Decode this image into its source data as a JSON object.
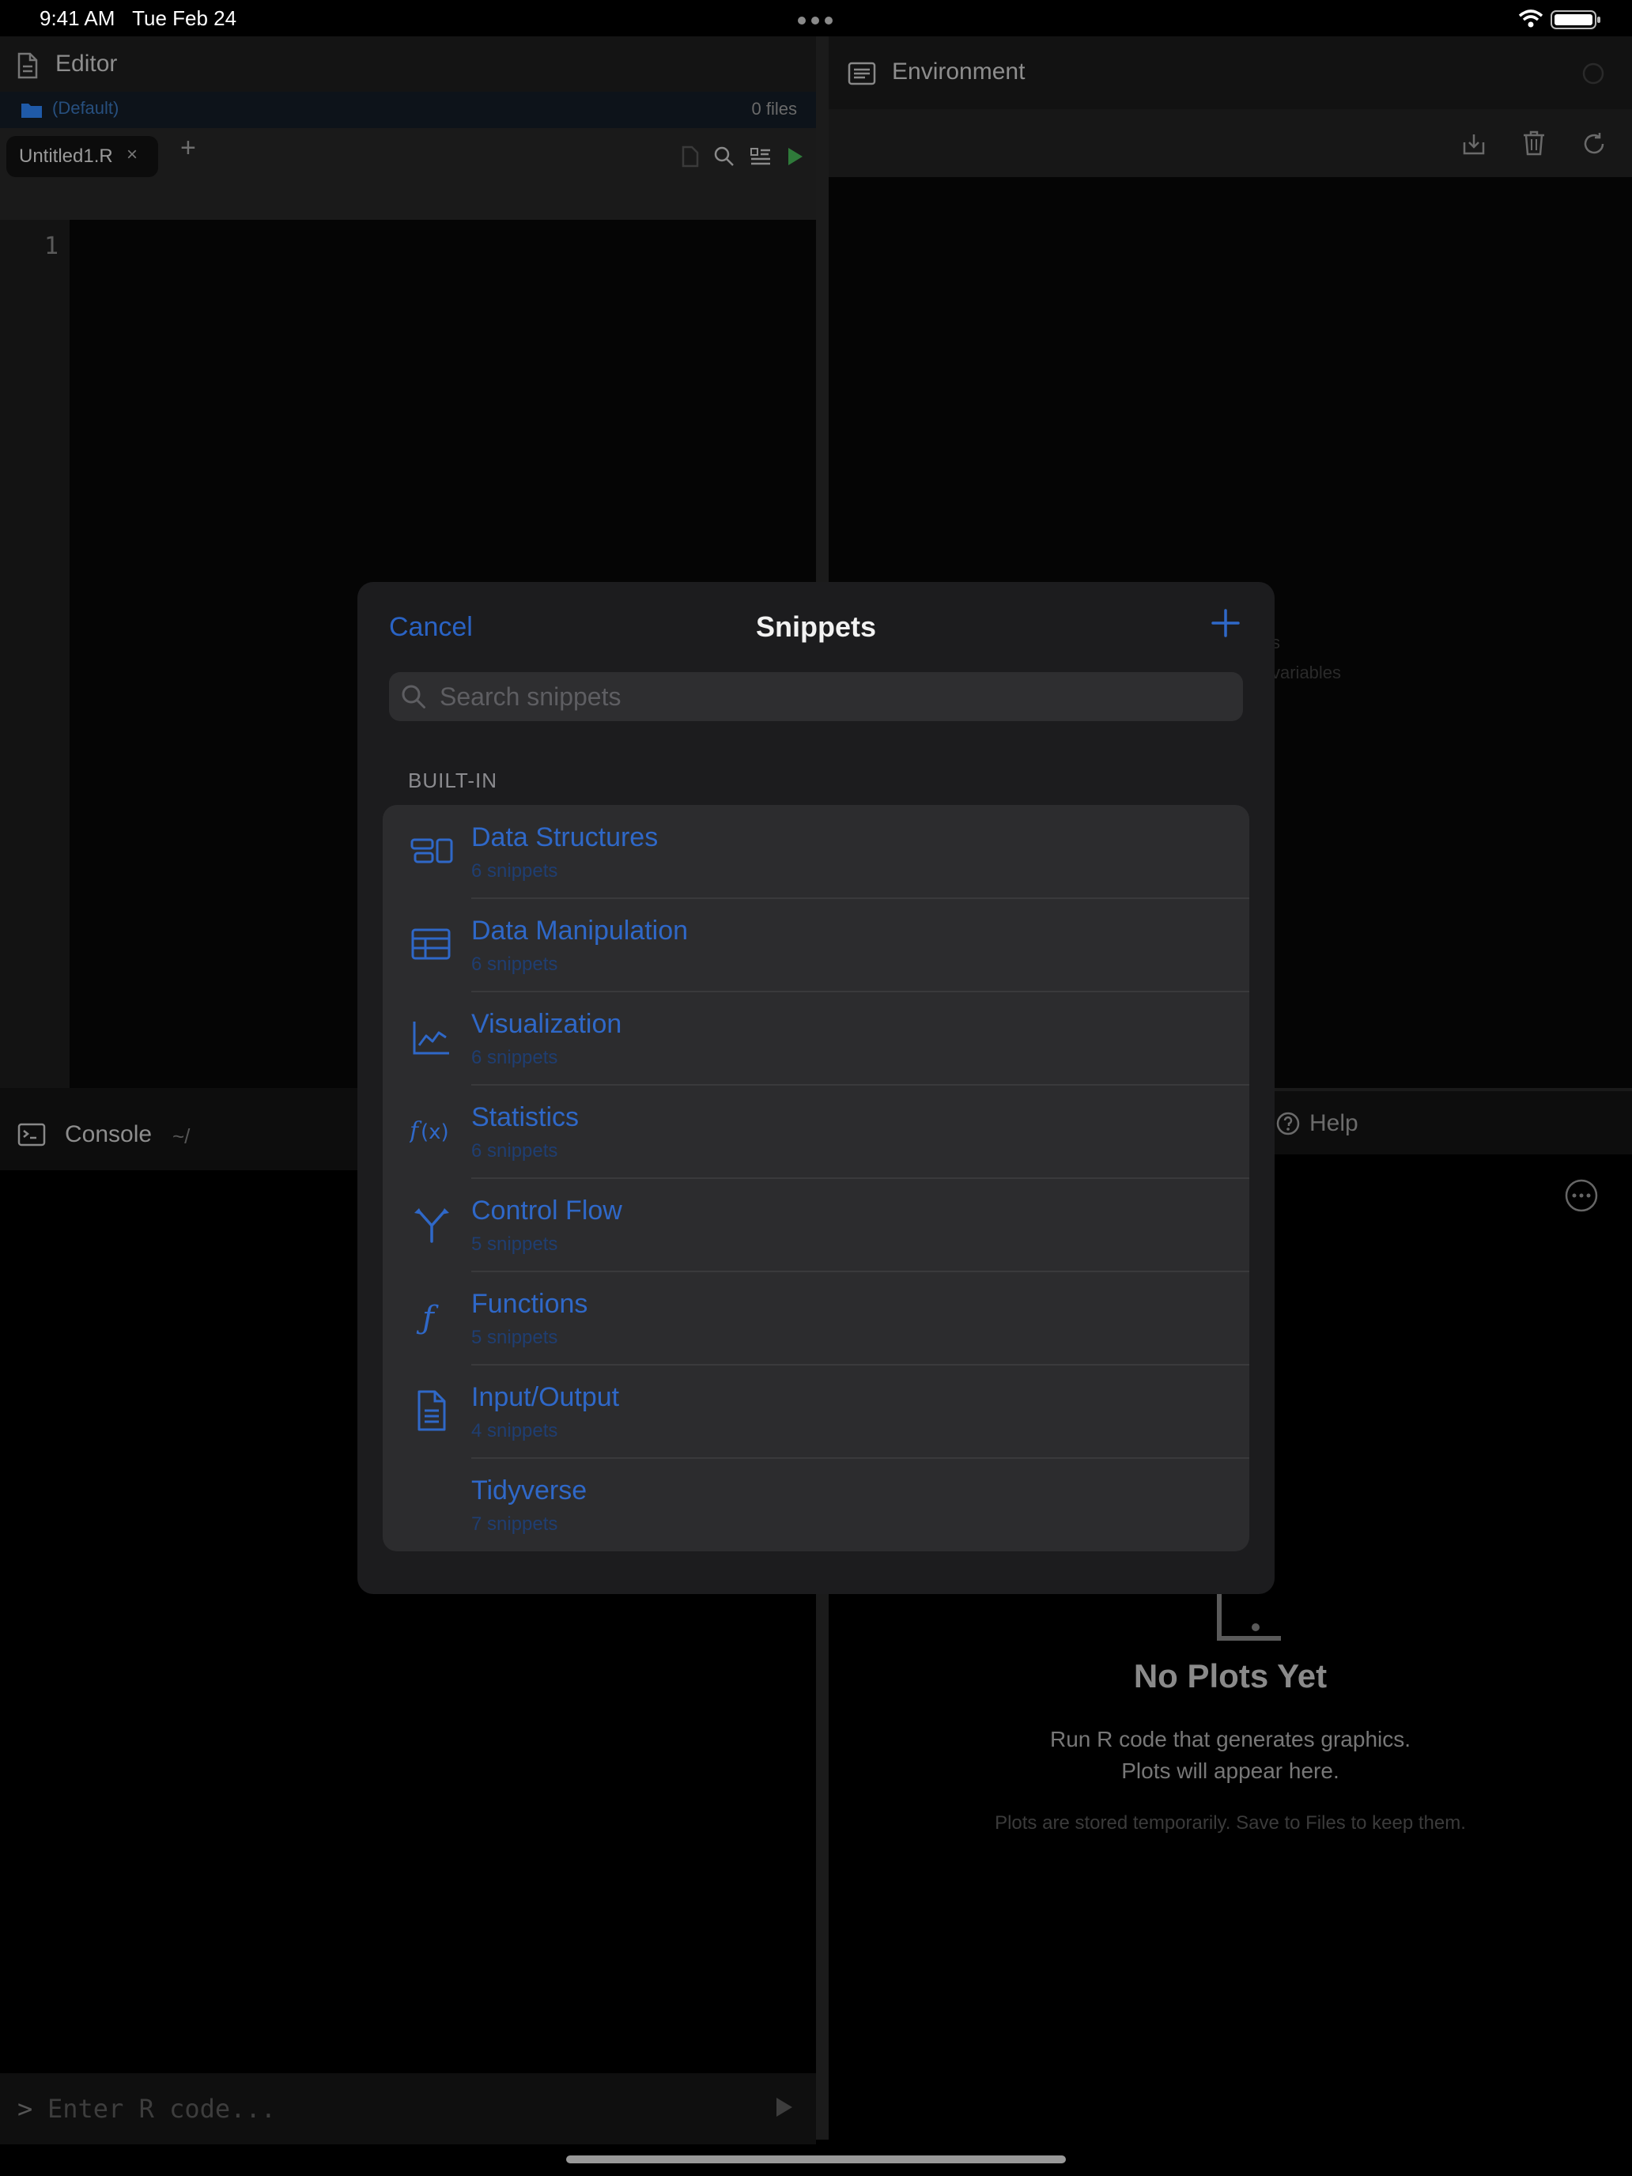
{
  "status_bar": {
    "time": "9:41 AM",
    "date": "Tue Feb 24"
  },
  "editor": {
    "title": "Editor",
    "project": "(Default)",
    "file_count": "0 files",
    "tab_label": "Untitled1.R",
    "tab_close": "×",
    "tab_add": "+",
    "line_number": "1"
  },
  "environment": {
    "title": "Environment",
    "empty_line_1": "s",
    "empty_line_2": "variables"
  },
  "console": {
    "title": "Console",
    "path": "~/",
    "prompt": ">",
    "placeholder": "Enter R code..."
  },
  "plots": {
    "help_label": "Help",
    "empty_title": "No Plots Yet",
    "empty_desc_1": "Run R code that generates graphics.",
    "empty_desc_2": "Plots will appear here.",
    "empty_note": "Plots are stored temporarily. Save to Files to keep them."
  },
  "modal": {
    "cancel_label": "Cancel",
    "title": "Snippets",
    "search_placeholder": "Search snippets",
    "section_header": "BUILT-IN",
    "categories": [
      {
        "title": "Data Structures",
        "count": "6 snippets",
        "icon": "data-structures-icon"
      },
      {
        "title": "Data Manipulation",
        "count": "6 snippets",
        "icon": "table-icon"
      },
      {
        "title": "Visualization",
        "count": "6 snippets",
        "icon": "line-chart-icon"
      },
      {
        "title": "Statistics",
        "count": "6 snippets",
        "icon": "function-x-icon"
      },
      {
        "title": "Control Flow",
        "count": "5 snippets",
        "icon": "branch-icon"
      },
      {
        "title": "Functions",
        "count": "5 snippets",
        "icon": "function-icon"
      },
      {
        "title": "Input/Output",
        "count": "4 snippets",
        "icon": "document-icon"
      },
      {
        "title": "Tidyverse",
        "count": "7 snippets",
        "icon": ""
      }
    ]
  },
  "colors": {
    "accent": "#2f68c8",
    "modal_bg": "#1c1c1e",
    "list_bg": "#2c2c2e"
  }
}
